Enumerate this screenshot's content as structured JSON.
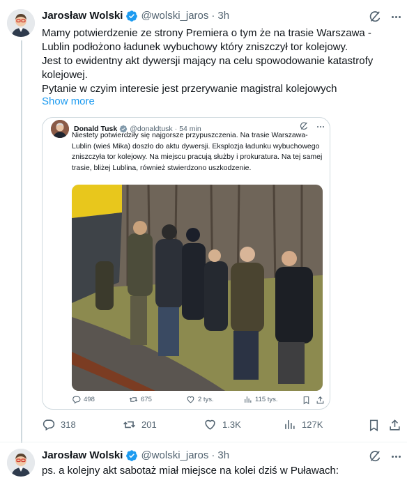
{
  "tweet": {
    "author_name": "Jarosław Wolski",
    "handle": "@wolski_jaros",
    "separator": "·",
    "time": "3h",
    "text_lines": [
      "Mamy potwierdzenie ze strony Premiera o tym że na trasie Warszawa - Lublin podłożono ładunek wybuchowy który zniszczył tor kolejowy.",
      "Jest to ewidentny akt dywersji mający na celu spowodowanie katastrofy kolejowej.",
      "Pytanie w czyim interesie jest przerywanie magistral kolejowych"
    ],
    "show_more": "Show more",
    "stats": {
      "replies": "318",
      "reposts": "201",
      "likes": "1.3K",
      "views": "127K"
    }
  },
  "quoted_tweet": {
    "author_name": "Donald Tusk",
    "handle": "@donaldtusk",
    "separator": "·",
    "time": "54 min",
    "text": "Niestety potwierdziły się najgorsze przypuszczenia. Na trasie Warszawa-Lublin (wieś Mika) doszło do aktu dywersji. Eksplozja ładunku wybuchowego zniszczyła tor kolejowy. Na miejscu pracują służby i prokuratura. Na tej samej trasie, bliżej Lublina, również stwierdzono uszkodzenie.",
    "stats": {
      "replies": "498",
      "reposts": "675",
      "likes": "2 tys.",
      "views": "115 tys."
    }
  },
  "reply": {
    "author_name": "Jarosław Wolski",
    "handle": "@wolski_jaros",
    "separator": "·",
    "time": "3h",
    "text": "ps. a kolejny akt sabotaż miał miejsce na kolei dziś w Puławach:"
  },
  "colors": {
    "accent": "#1d9bf0",
    "text_primary": "#0f1419",
    "text_secondary": "#536471",
    "border": "#cfd9de",
    "verified_badge": "#1d9bf0"
  },
  "icons": [
    "verified-badge-icon",
    "grok-icon",
    "more-icon",
    "reply-icon",
    "repost-icon",
    "like-icon",
    "views-icon",
    "bookmark-icon",
    "share-icon"
  ]
}
